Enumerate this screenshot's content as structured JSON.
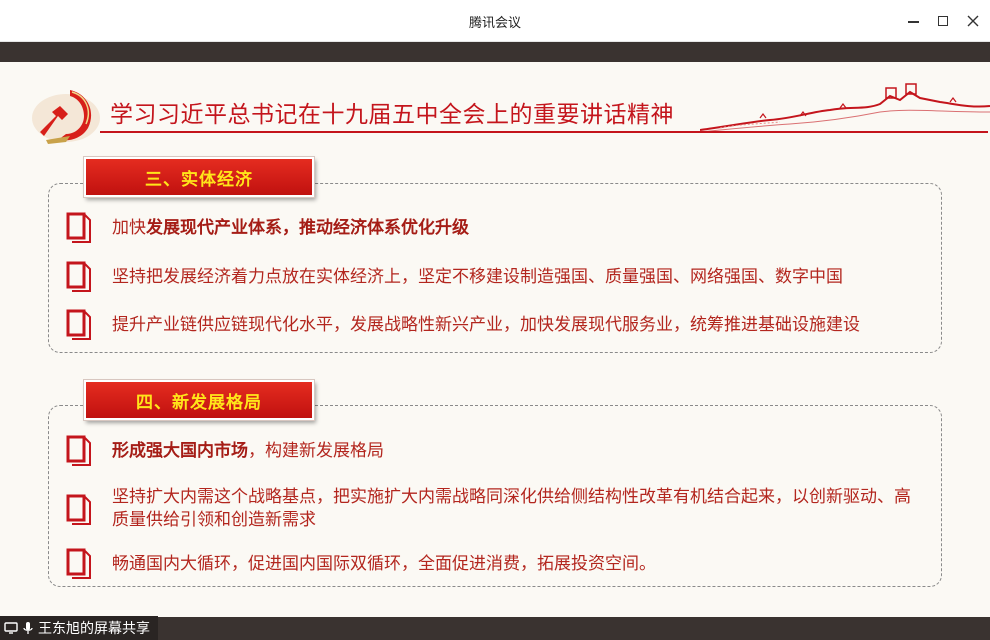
{
  "window": {
    "title": "腾讯会议"
  },
  "slide": {
    "headline": "学习习近平总书记在十九届五中全会上的重要讲话精神",
    "sections": [
      {
        "title": "三、实体经济",
        "items": [
          {
            "prefix": "加快",
            "bold": "发展现代产业体系，推动经济体系优化升级",
            "suffix": ""
          },
          {
            "prefix": "坚持把发展经济着力点放在实体经济上，坚定不移建设制造强国、质量强国、网络强国、数字中国",
            "bold": "",
            "suffix": ""
          },
          {
            "prefix": "提升产业链供应链现代化水平，发展战略性新兴产业，加快发展现代服务业，统筹推进基础设施建设",
            "bold": "",
            "suffix": ""
          }
        ]
      },
      {
        "title": "四、新发展格局",
        "items": [
          {
            "prefix": "",
            "bold": "形成强大国内市场",
            "suffix": "，构建新发展格局"
          },
          {
            "prefix": "坚持扩大内需这个战略基点，把实施扩大内需战略同深化供给侧结构性改革有机结合起来，以创新驱动、高质量供给引领和创造新需求",
            "bold": "",
            "suffix": ""
          },
          {
            "prefix": "畅通国内大循环，促进国内国际双循环，全面促进消费，拓展投资空间。",
            "bold": "",
            "suffix": ""
          }
        ]
      }
    ]
  },
  "status": {
    "share_label": "王东旭的屏幕共享"
  },
  "icons": {
    "emblem": "party-emblem-icon",
    "wall": "great-wall-icon",
    "bullet": "document-icon",
    "share": "screen-share-icon",
    "mic": "microphone-icon"
  },
  "colors": {
    "accent_red": "#c4151c",
    "header_yellow": "#ffe51a",
    "bar_dark": "#3a3330",
    "slide_bg": "#fbf9f4"
  }
}
